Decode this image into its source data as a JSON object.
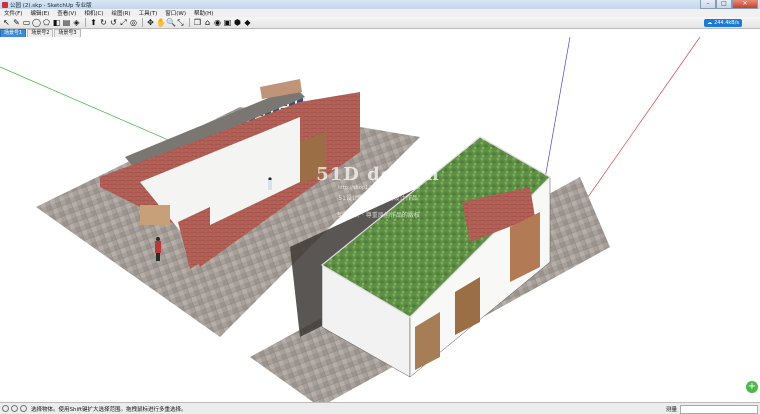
{
  "window": {
    "title": "公园 (2).skp - SketchUp 专业版",
    "buttons": {
      "minimize": "–",
      "maximize": "□",
      "close": "✕"
    }
  },
  "menu": {
    "items": [
      "文件(F)",
      "编辑(E)",
      "查看(V)",
      "相机(C)",
      "绘图(R)",
      "工具(T)",
      "窗口(W)",
      "帮助(H)"
    ]
  },
  "toolbar": {
    "tools": [
      {
        "name": "select-icon",
        "glyph": "↖"
      },
      {
        "name": "pencil-icon",
        "glyph": "✎"
      },
      {
        "name": "rectangle-icon",
        "glyph": "▭"
      },
      {
        "name": "circle-icon",
        "glyph": "◯"
      },
      {
        "name": "polygon-icon",
        "glyph": "⬠"
      },
      {
        "name": "eraser-icon",
        "glyph": "◧"
      },
      {
        "name": "tape-icon",
        "glyph": "▤"
      },
      {
        "name": "paint-bucket-icon",
        "glyph": "◈"
      },
      {
        "name": "push-pull-icon",
        "glyph": "⬆"
      },
      {
        "name": "rotate-icon",
        "glyph": "↻"
      },
      {
        "name": "follow-me-icon",
        "glyph": "↺"
      },
      {
        "name": "scale-icon",
        "glyph": "⤢"
      },
      {
        "name": "offset-icon",
        "glyph": "◎"
      },
      {
        "name": "orbit-icon",
        "glyph": "✥"
      },
      {
        "name": "pan-icon",
        "glyph": "✋"
      },
      {
        "name": "zoom-icon",
        "glyph": "🔍"
      },
      {
        "name": "zoom-extents-icon",
        "glyph": "⤡"
      },
      {
        "name": "components-icon",
        "glyph": "❒"
      },
      {
        "name": "warehouse-icon",
        "glyph": "⌂"
      },
      {
        "name": "geo-location-icon",
        "glyph": "◉"
      },
      {
        "name": "photo-textures-icon",
        "glyph": "▣"
      },
      {
        "name": "extension-icon",
        "glyph": "⬢"
      },
      {
        "name": "model-info-icon",
        "glyph": "◆"
      }
    ],
    "cloud_badge": "244.4kB/s"
  },
  "scenes": {
    "tabs": [
      "场景号1",
      "场景号2",
      "场景号3"
    ]
  },
  "watermark": {
    "logo": "51D design",
    "url": "http://shop127113...taobao.com",
    "line1": "51设计网 · 出售原创设计作品",
    "line2": "专有设计 · 尊重原创作品的版权"
  },
  "status": {
    "hint": "选择物体。使用Shift键扩大选择范围。拖拽鼠标进行多重选择。",
    "measure_label": "测量"
  }
}
